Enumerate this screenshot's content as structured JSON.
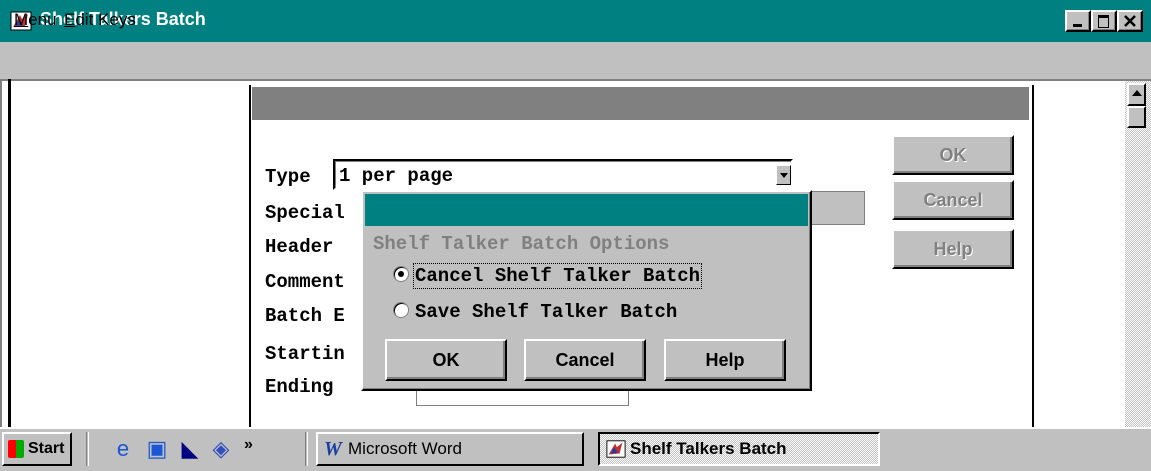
{
  "window": {
    "title": "Shelf Talkers Batch",
    "icon": "shelf-talkers-app-icon"
  },
  "menu": {
    "items": [
      "Menu",
      "Edit Keys"
    ]
  },
  "form": {
    "labels": {
      "type": "Type",
      "special": "Special",
      "header": "Header",
      "comment": "Comment",
      "batch": "Batch E",
      "starting": "Startin",
      "ending": "Ending"
    },
    "type_value": "1 per page",
    "buttons": {
      "ok": "OK",
      "cancel": "Cancel",
      "help": "Help"
    }
  },
  "dialog": {
    "heading": "Shelf Talker Batch Options",
    "options": [
      {
        "label": "Cancel Shelf Talker Batch",
        "selected": true
      },
      {
        "label": "Save Shelf Talker Batch",
        "selected": false
      }
    ],
    "buttons": {
      "ok": "OK",
      "cancel": "Cancel",
      "help": "Help"
    }
  },
  "taskbar": {
    "start": "Start",
    "quick_launch": [
      "internet-explorer-icon",
      "show-desktop-icon",
      "view-channels-icon",
      "quick-launch-extra-icon"
    ],
    "more": "»",
    "tasks": [
      "Microsoft Word",
      "Shelf Talkers Batch"
    ]
  },
  "colors": {
    "titlebar": "#008080",
    "face": "#c0c0c0",
    "form_caption": "#808080"
  }
}
